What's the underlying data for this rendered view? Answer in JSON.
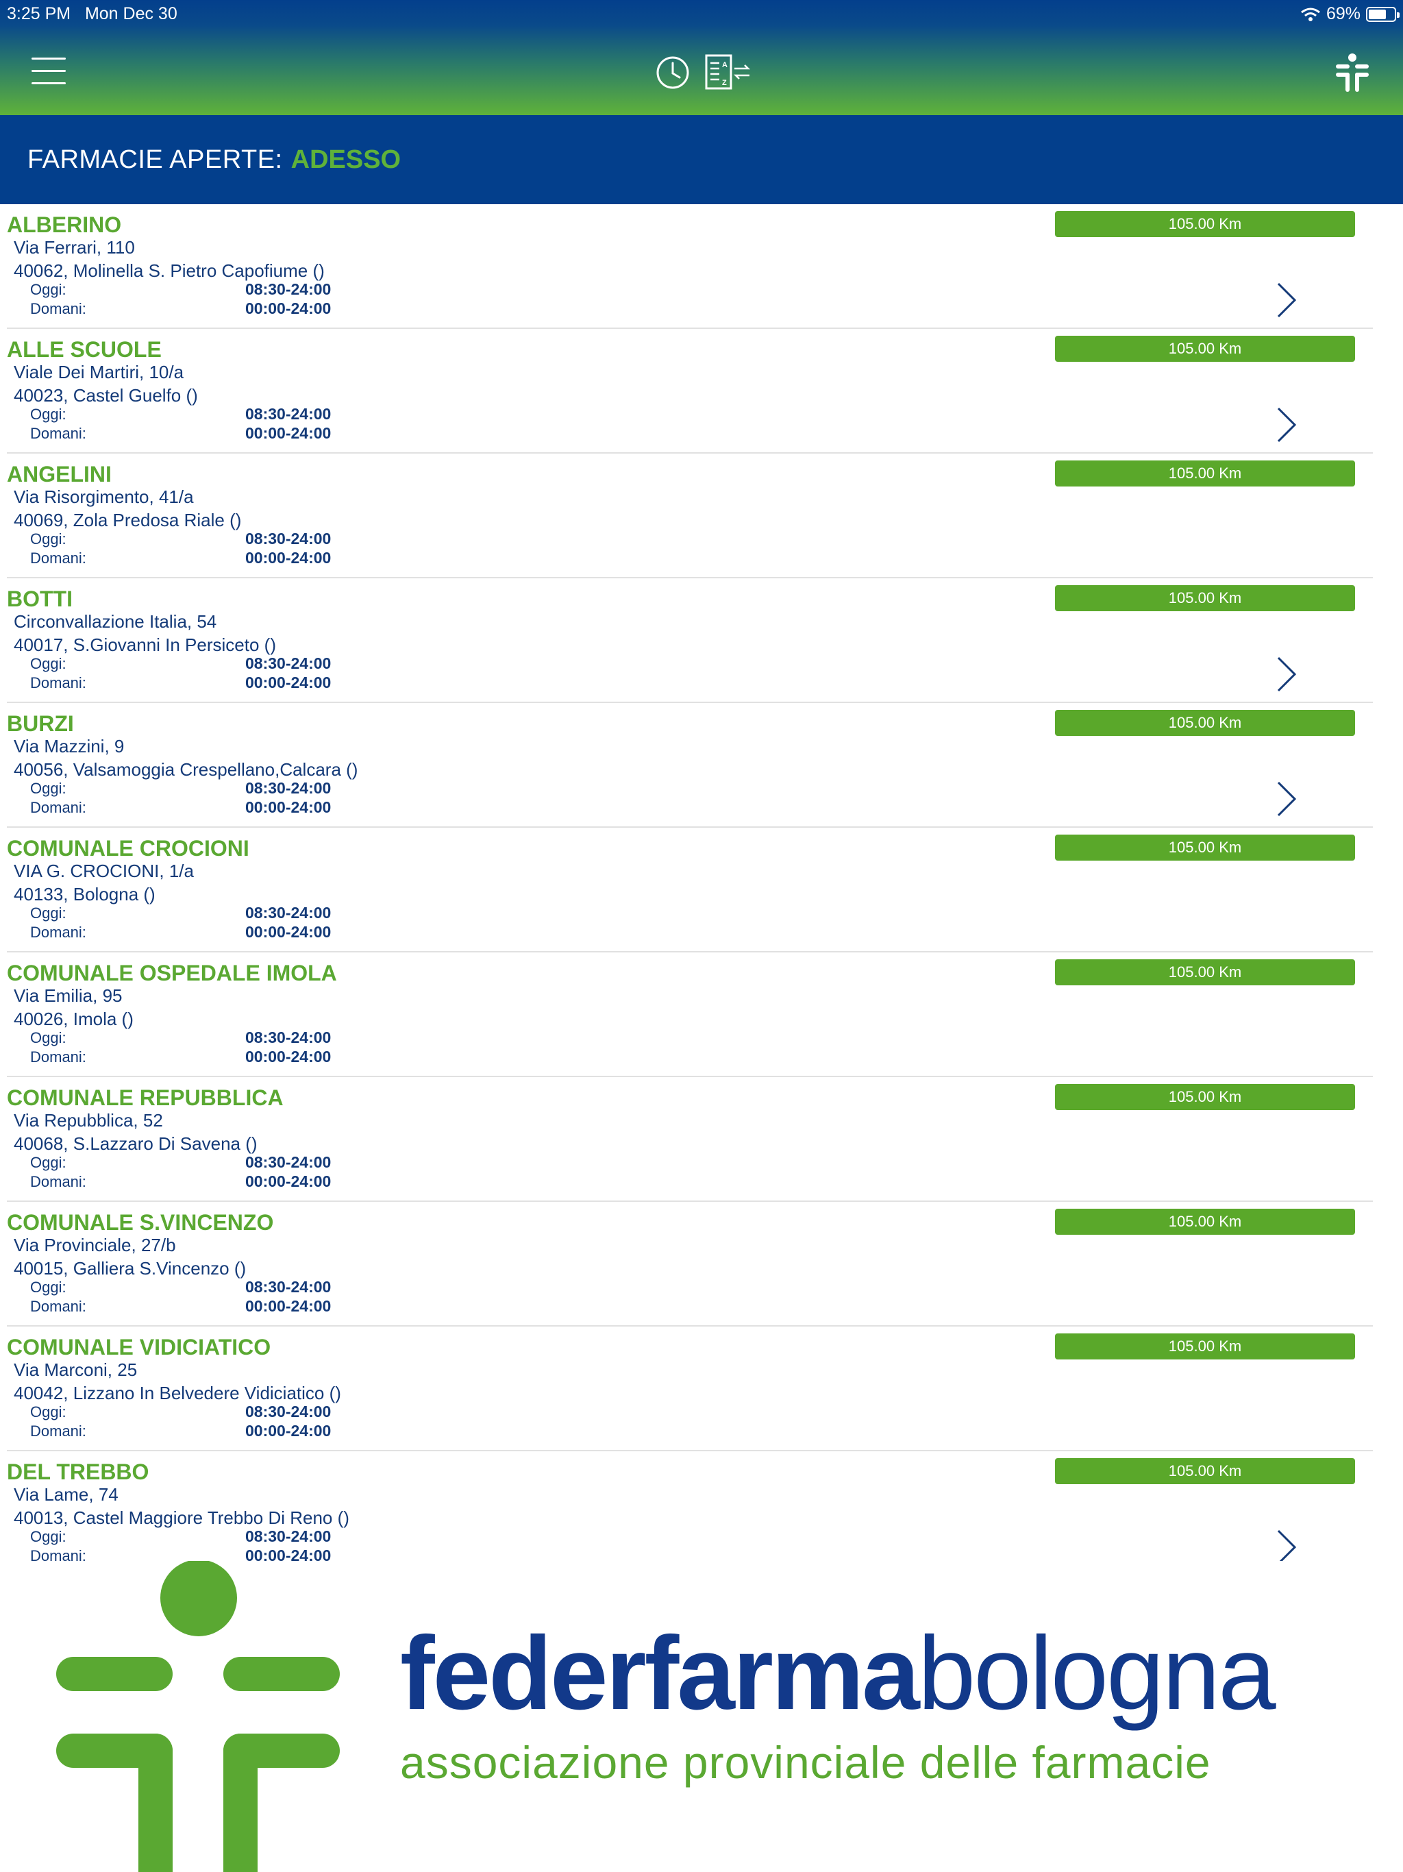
{
  "status_bar": {
    "time": "3:25 PM",
    "date": "Mon Dec 30",
    "battery": "69%",
    "battery_level": 0.69
  },
  "header": {
    "icons": [
      "menu-icon",
      "clock-icon",
      "sort-az-icon",
      "federfarma-logo-icon"
    ]
  },
  "title": {
    "prefix": "FARMACIE APERTE:",
    "highlight": "ADESSO"
  },
  "labels": {
    "today": "Oggi:",
    "tomorrow": "Domani:"
  },
  "pharmacies": [
    {
      "name": "ALBERINO",
      "street": "Via Ferrari, 110",
      "city": "40062, Molinella S. Pietro Capofiume ()",
      "today": "08:30-24:00",
      "tomorrow": "00:00-24:00",
      "distance": "105.00 Km",
      "has_detail": true
    },
    {
      "name": "ALLE SCUOLE",
      "street": "Viale Dei Martiri, 10/a",
      "city": "40023, Castel Guelfo ()",
      "today": "08:30-24:00",
      "tomorrow": "00:00-24:00",
      "distance": "105.00 Km",
      "has_detail": true
    },
    {
      "name": "ANGELINI",
      "street": "Via Risorgimento, 41/a",
      "city": "40069, Zola Predosa Riale ()",
      "today": "08:30-24:00",
      "tomorrow": "00:00-24:00",
      "distance": "105.00 Km",
      "has_detail": false
    },
    {
      "name": "BOTTI",
      "street": "Circonvallazione Italia, 54",
      "city": "40017, S.Giovanni In Persiceto ()",
      "today": "08:30-24:00",
      "tomorrow": "00:00-24:00",
      "distance": "105.00 Km",
      "has_detail": true
    },
    {
      "name": "BURZI",
      "street": "Via Mazzini, 9",
      "city": "40056, Valsamoggia Crespellano,Calcara ()",
      "today": "08:30-24:00",
      "tomorrow": "00:00-24:00",
      "distance": "105.00 Km",
      "has_detail": true
    },
    {
      "name": "COMUNALE CROCIONI",
      "street": "VIA G. CROCIONI, 1/a",
      "city": "40133, Bologna ()",
      "today": "08:30-24:00",
      "tomorrow": "00:00-24:00",
      "distance": "105.00 Km",
      "has_detail": false
    },
    {
      "name": "COMUNALE OSPEDALE IMOLA",
      "street": "Via Emilia, 95",
      "city": "40026, Imola ()",
      "today": "08:30-24:00",
      "tomorrow": "00:00-24:00",
      "distance": "105.00 Km",
      "has_detail": false
    },
    {
      "name": "COMUNALE REPUBBLICA",
      "street": "Via Repubblica, 52",
      "city": "40068, S.Lazzaro Di Savena ()",
      "today": "08:30-24:00",
      "tomorrow": "00:00-24:00",
      "distance": "105.00 Km",
      "has_detail": false
    },
    {
      "name": "COMUNALE S.VINCENZO",
      "street": "Via Provinciale, 27/b",
      "city": "40015, Galliera S.Vincenzo ()",
      "today": "08:30-24:00",
      "tomorrow": "00:00-24:00",
      "distance": "105.00 Km",
      "has_detail": false
    },
    {
      "name": "COMUNALE VIDICIATICO",
      "street": "Via Marconi, 25",
      "city": "40042, Lizzano In Belvedere Vidiciatico ()",
      "today": "08:30-24:00",
      "tomorrow": "00:00-24:00",
      "distance": "105.00 Km",
      "has_detail": false
    },
    {
      "name": "DEL TREBBO",
      "street": "Via Lame, 74",
      "city": "40013, Castel Maggiore Trebbo Di Reno ()",
      "today": "08:30-24:00",
      "tomorrow": "00:00-24:00",
      "distance": "105.00 Km",
      "has_detail": true
    }
  ],
  "banner": {
    "brand_bold": "federfarma",
    "brand_light": "bologna",
    "tagline": "associazione provinciale delle farmacie"
  },
  "colors": {
    "primary_blue": "#033f8c",
    "accent_green": "#5aa832",
    "text_blue": "#143a78"
  }
}
